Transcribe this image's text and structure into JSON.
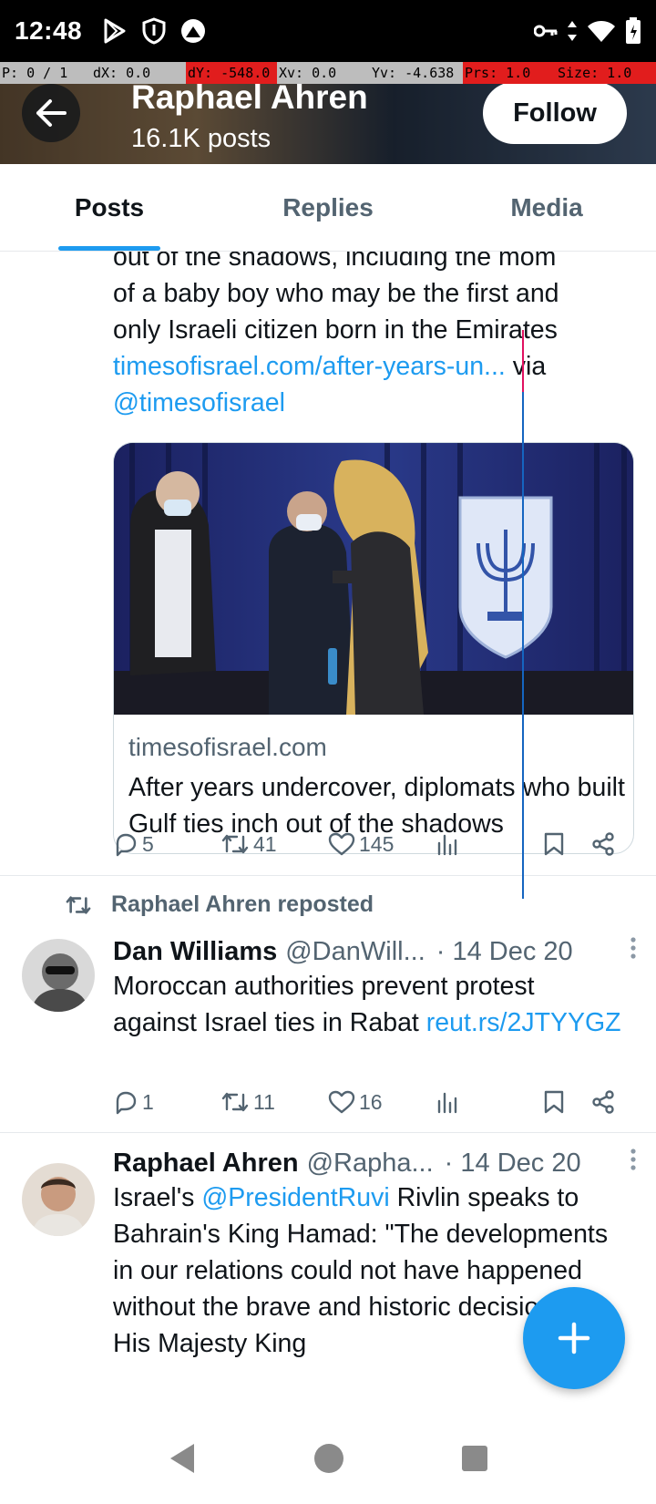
{
  "status_bar": {
    "time": "12:48",
    "left_icons": [
      "play-store-icon",
      "shield-icon",
      "app-notification-icon"
    ],
    "right_icons": [
      "vpn-key-icon",
      "data-arrows-icon",
      "wifi-icon",
      "battery-icon"
    ]
  },
  "debug": {
    "p": "P: 0 / 1",
    "dx": "dX: 0.0",
    "dy": "dY: -548.0",
    "xv": "Xv: 0.0",
    "yv": "Yv: -4.638",
    "prs": "Prs: 1.0",
    "size": "Size: 1.0"
  },
  "header": {
    "name": "Raphael Ahren",
    "posts_count": "16.1K posts",
    "follow_label": "Follow"
  },
  "tabs": [
    {
      "label": "Posts",
      "active": true
    },
    {
      "label": "Replies",
      "active": false
    },
    {
      "label": "Media",
      "active": false
    }
  ],
  "post1": {
    "text_lines": [
      "out of the shadows, including the mom",
      "of a baby boy who may be the first and",
      "only Israeli citizen born in the Emirates"
    ],
    "link": "timesofisrael.com/after-years-un...",
    "via": "via",
    "mention": "@timesofisrael",
    "card": {
      "domain": "timesofisrael.com",
      "title": "After years undercover, diplomats who built Gulf ties inch out of the shadows"
    },
    "replies": "5",
    "reposts": "41",
    "likes": "145"
  },
  "repost_label": "Raphael Ahren reposted",
  "post2": {
    "name": "Dan Williams",
    "handle": "@DanWill...",
    "date": "· 14 Dec 20",
    "text": "Moroccan authorities prevent protest against Israel ties in Rabat",
    "link": "reut.rs/2JTYYGZ",
    "replies": "1",
    "reposts": "11",
    "likes": "16"
  },
  "post3": {
    "name": "Raphael Ahren",
    "handle": "@Rapha...",
    "date": "· 14 Dec 20",
    "text_prefix": "Israel's",
    "mention": "@PresidentRuvi",
    "text_rest": "Rivlin speaks to Bahrain's King Hamad: \"The developments in our relations could not have happened without the brave and historic decision of His Majesty King"
  },
  "colors": {
    "accent": "#1d9bf0",
    "text_primary": "#0f1419",
    "text_secondary": "#536471",
    "divider": "#e6e9ec"
  }
}
